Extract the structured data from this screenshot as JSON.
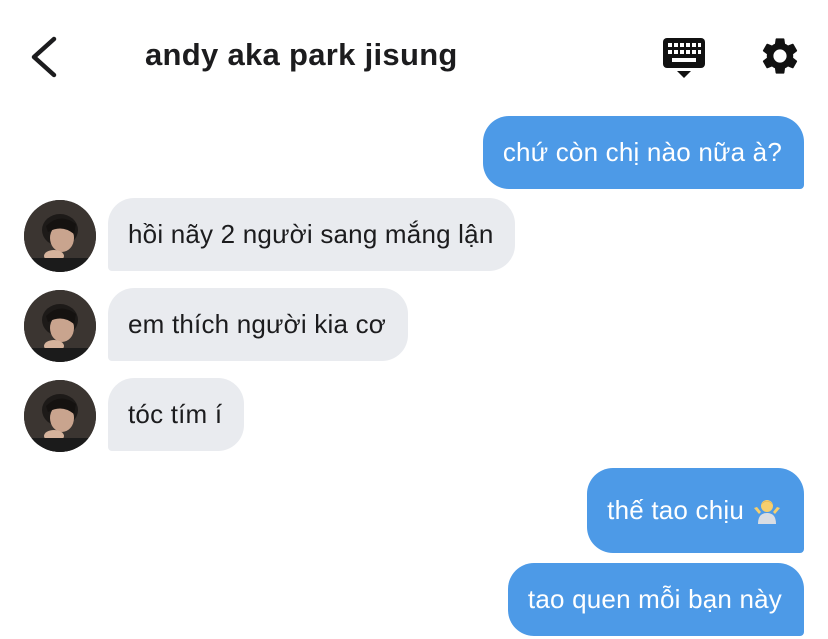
{
  "header": {
    "title": "andy aka park jisung",
    "back_icon": "chevron-left-icon",
    "keyboard_icon": "keyboard-icon",
    "settings_icon": "gear-icon"
  },
  "colors": {
    "outgoing_bubble": "#4d9ae7",
    "incoming_bubble": "#e9ebef",
    "text_dark": "#1c1c1e"
  },
  "messages": [
    {
      "direction": "outgoing",
      "text": "chứ còn chị nào nữa à?"
    },
    {
      "direction": "incoming",
      "text": "hồi nãy 2 người sang mắng lận"
    },
    {
      "direction": "incoming",
      "text": "em thích người kia cơ"
    },
    {
      "direction": "incoming",
      "text": "tóc tím í"
    },
    {
      "direction": "outgoing",
      "text": "thế tao chịu",
      "emoji": "person-shrugging-emoji"
    },
    {
      "direction": "outgoing",
      "text": "tao quen mỗi bạn này"
    }
  ]
}
